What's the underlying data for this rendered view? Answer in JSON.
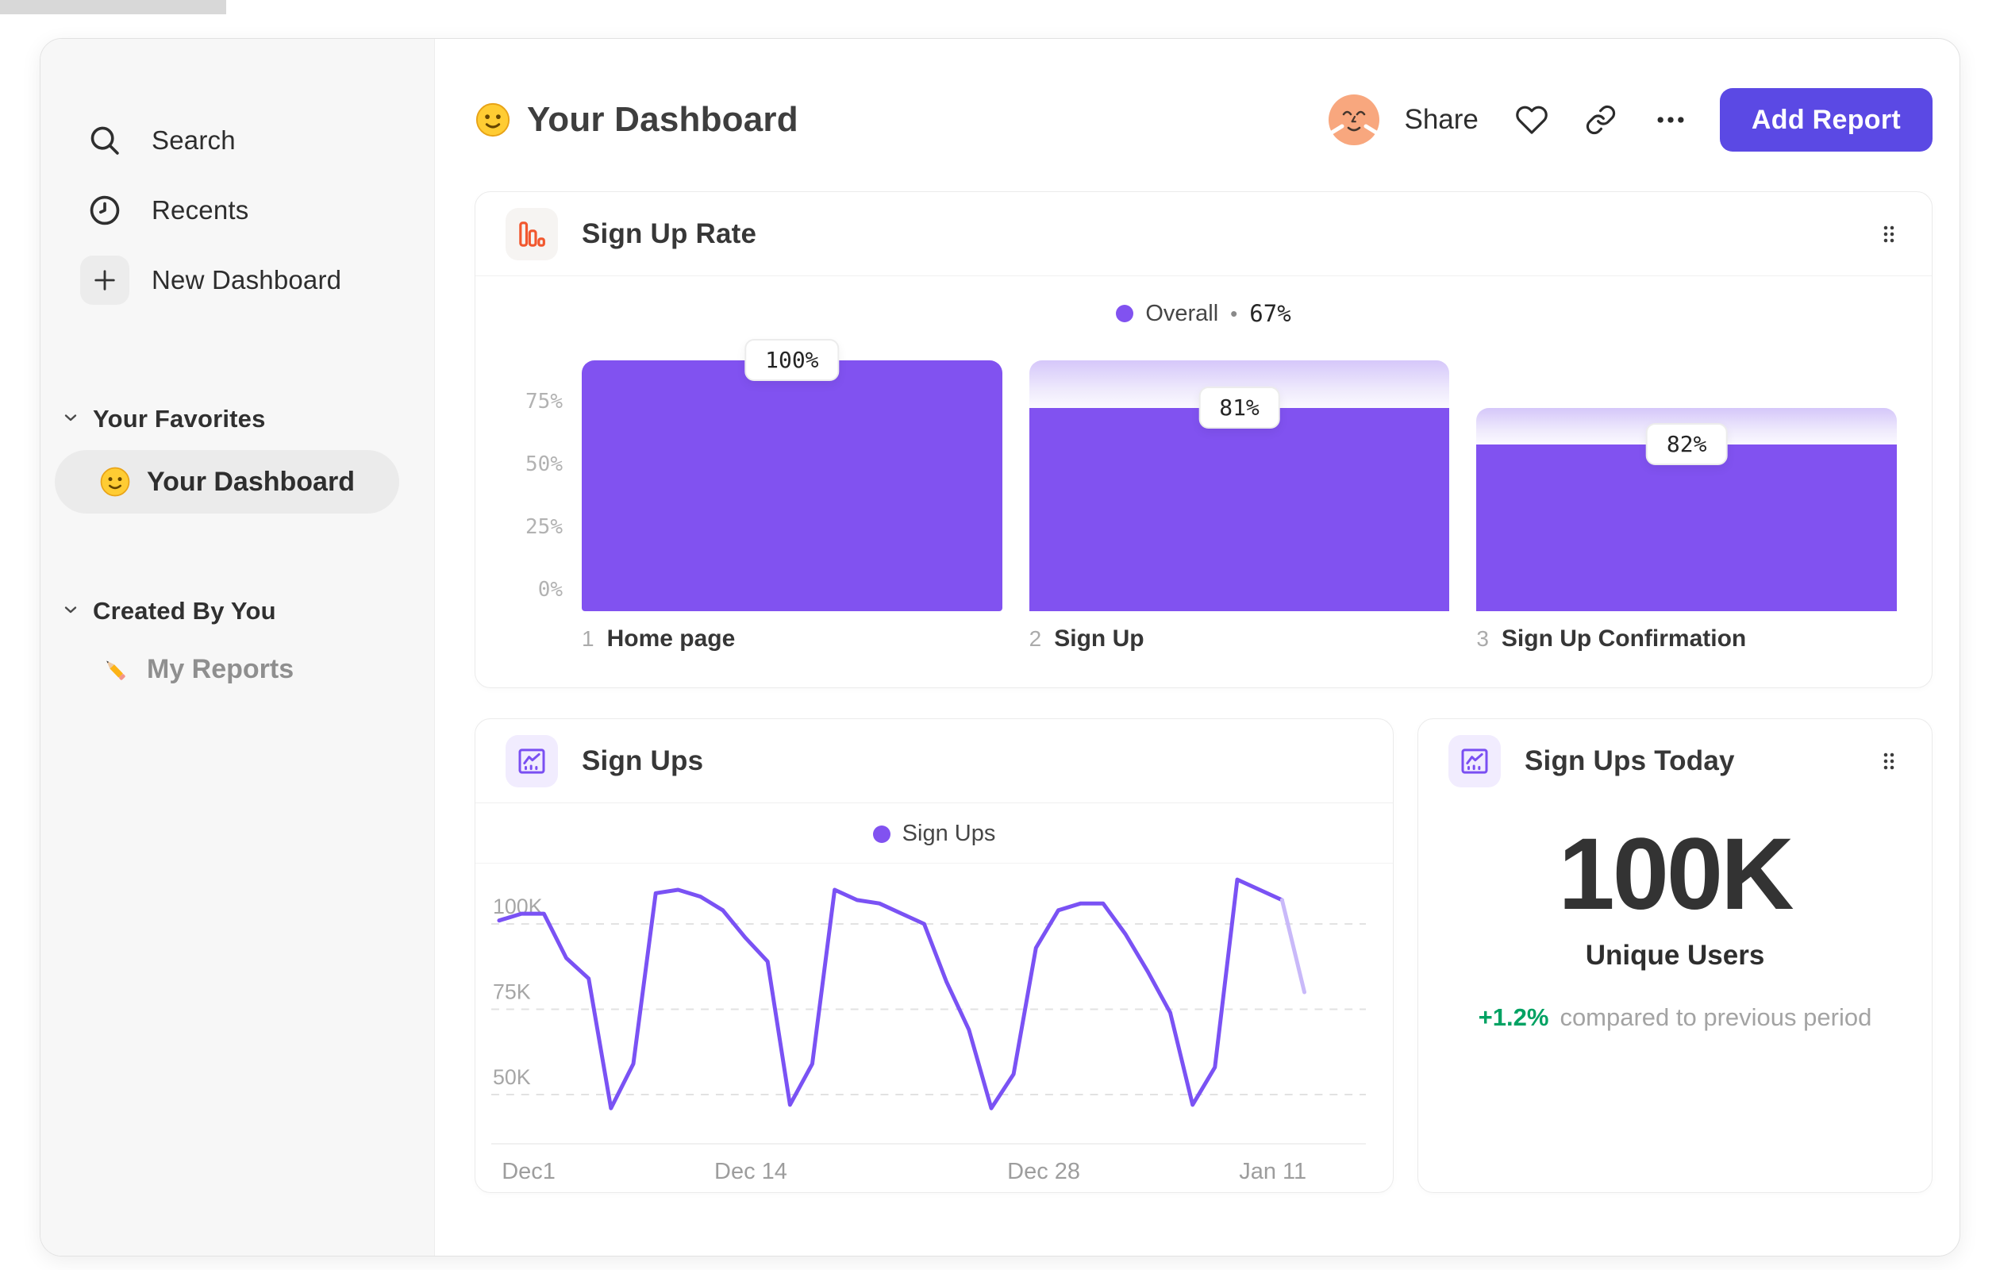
{
  "header": {
    "title": "Your Dashboard",
    "title_icon": "smiley-emoji",
    "share_label": "Share",
    "add_report_label": "Add Report",
    "action_icons": [
      "heart-icon",
      "link-icon",
      "ellipsis-icon"
    ]
  },
  "sidebar": {
    "nav": [
      {
        "icon": "search-icon",
        "label": "Search"
      },
      {
        "icon": "clock-icon",
        "label": "Recents"
      },
      {
        "icon": "plus-icon",
        "label": "New Dashboard"
      }
    ],
    "sections": [
      {
        "title": "Your Favorites",
        "items": [
          {
            "icon": "smiley-emoji",
            "label": "Your Dashboard",
            "selected": true
          }
        ]
      },
      {
        "title": "Created By You",
        "items": [
          {
            "icon": "pencil-emoji",
            "label": "My Reports",
            "selected": false
          }
        ]
      }
    ]
  },
  "chart_data": [
    {
      "type": "bar",
      "title": "Sign Up Rate",
      "icon": "funnel-bars-icon",
      "legend": {
        "label": "Overall",
        "separator": "•",
        "value": "67%"
      },
      "y_ticks": [
        {
          "label": "0%",
          "value": 0
        },
        {
          "label": "25%",
          "value": 25
        },
        {
          "label": "50%",
          "value": 50
        },
        {
          "label": "75%",
          "value": 75
        }
      ],
      "ylim": [
        0,
        100
      ],
      "steps": [
        {
          "step": "1",
          "label": "Home page",
          "conversion": "100%",
          "cumulative": 100
        },
        {
          "step": "2",
          "label": "Sign Up",
          "conversion": "81%",
          "cumulative": 81
        },
        {
          "step": "3",
          "label": "Sign Up Confirmation",
          "conversion": "82%",
          "cumulative": 66.4
        }
      ]
    },
    {
      "type": "line",
      "title": "Sign Ups",
      "icon": "line-chart-icon",
      "legend": "Sign Ups",
      "unit": "K users",
      "y_gridlines": [
        {
          "label": "100K",
          "value": 100
        },
        {
          "label": "75K",
          "value": 75
        },
        {
          "label": "50K",
          "value": 50
        }
      ],
      "x_ticks": [
        {
          "label": "Dec1",
          "pos": 1.2
        },
        {
          "label": "Dec 14",
          "pos": 25.5
        },
        {
          "label": "Dec 28",
          "pos": 59.0
        },
        {
          "label": "Jan 11",
          "pos": 85.5
        }
      ],
      "values": [
        101,
        103,
        103,
        90,
        84,
        46,
        59,
        109,
        110,
        108,
        104,
        96,
        89,
        47,
        59,
        110,
        107,
        106,
        103,
        100,
        83,
        69,
        46,
        56,
        93,
        104,
        106,
        106,
        97,
        86,
        74,
        47,
        58,
        113,
        110,
        107,
        80
      ],
      "faded_tail_segments": 1
    },
    {
      "type": "metric",
      "title": "Sign Ups Today",
      "icon": "line-chart-icon",
      "value": "100K",
      "label": "Unique Users",
      "delta": "+1.2%",
      "delta_note": "compared to previous period"
    }
  ],
  "colors": {
    "bar-purple": "#8152f0",
    "line-purple": "#7a52f4",
    "line-faded": "#c9b9f9",
    "accent-purple": "#5b49e4",
    "funnel-orange": "#f1572e",
    "positive-green": "#00a263",
    "avatar-bg": "#f8a77e"
  }
}
